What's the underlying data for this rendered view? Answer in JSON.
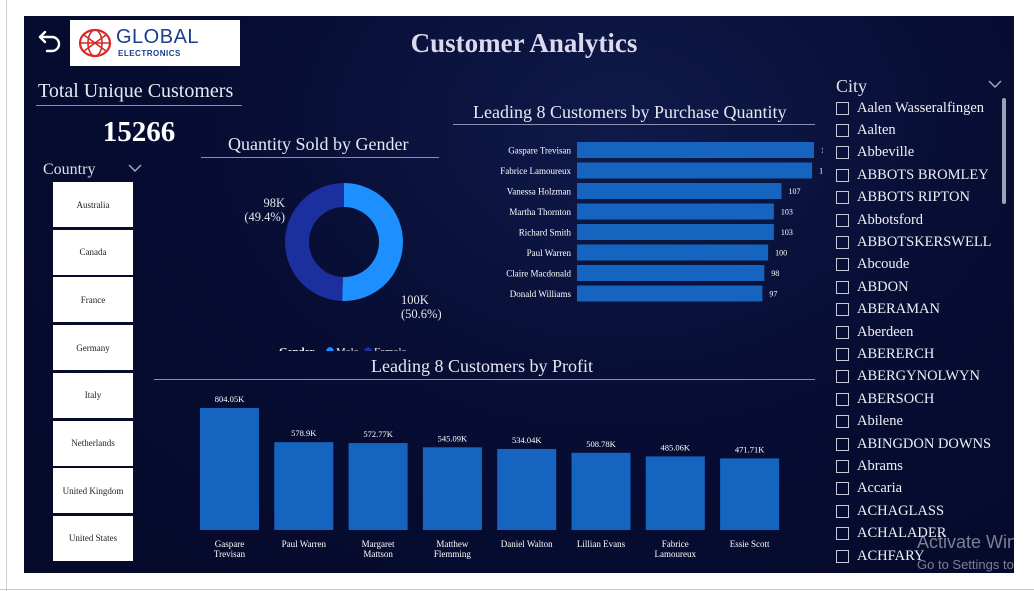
{
  "header": {
    "title": "Customer Analytics",
    "logo_main": "GLOBAL",
    "logo_sub": "ELECTRONICS"
  },
  "kpi": {
    "label": "Total Unique Customers",
    "value": "15266"
  },
  "country_filter": {
    "label": "Country",
    "items": [
      "Australia",
      "Canada",
      "France",
      "Germany",
      "Italy",
      "Netherlands",
      "United Kingdom",
      "United States"
    ]
  },
  "city_filter": {
    "label": "City",
    "items": [
      "Aalen Wasseralfingen",
      "Aalten",
      "Abbeville",
      "ABBOTS BROMLEY",
      "ABBOTS RIPTON",
      "Abbotsford",
      "ABBOTSKERSWELL",
      "Abcoude",
      "ABDON",
      "ABERAMAN",
      "Aberdeen",
      "ABERERCH",
      "ABERGYNOLWYN",
      "ABERSOCH",
      "Abilene",
      "ABINGDON DOWNS",
      "Abrams",
      "Accaria",
      "ACHAGLASS",
      "ACHALADER",
      "ACHFARY"
    ]
  },
  "watermark": {
    "line1": "Activate Windows",
    "line2": "Go to Settings to activate Windows."
  },
  "colors": {
    "male": "#1e8fff",
    "female": "#1b2f9e",
    "bar": "#1565c0",
    "background": "#060c30"
  },
  "chart_data": [
    {
      "type": "pie",
      "title": "Quantity Sold by Gender",
      "legend_title": "Gender",
      "legend_position": "bottom",
      "slices": [
        {
          "name": "Male",
          "value": 100,
          "label": "100K",
          "percent_label": "(50.6%)"
        },
        {
          "name": "Female",
          "value": 98,
          "label": "98K",
          "percent_label": "(49.4%)"
        }
      ]
    },
    {
      "type": "bar",
      "orientation": "horizontal",
      "title": "Leading 8 Customers by Purchase Quantity",
      "categories": [
        "Gaspare Trevisan",
        "Fabrice Lamoureux",
        "Vanessa Holzman",
        "Martha Thornton",
        "Richard Smith",
        "Paul Warren",
        "Claire Macdonald",
        "Donald Williams"
      ],
      "values": [
        124,
        123,
        107,
        103,
        103,
        100,
        98,
        97
      ],
      "xlim": [
        0,
        124
      ]
    },
    {
      "type": "bar",
      "orientation": "vertical",
      "title": "Leading 8 Customers by Profit",
      "categories": [
        [
          "Gaspare",
          "Trevisan"
        ],
        [
          "Paul Warren"
        ],
        [
          "Margaret",
          "Mattson"
        ],
        [
          "Matthew",
          "Flemming"
        ],
        [
          "Daniel Walton"
        ],
        [
          "Lillian Evans"
        ],
        [
          "Fabrice",
          "Lamoureux"
        ],
        [
          "Essie Scott"
        ]
      ],
      "values": [
        804.05,
        578.9,
        572.77,
        545.09,
        534.04,
        508.78,
        485.06,
        471.71
      ],
      "labels": [
        "804.05K",
        "578.9K",
        "572.77K",
        "545.09K",
        "534.04K",
        "508.78K",
        "485.06K",
        "471.71K"
      ],
      "ylim": [
        0,
        804.05
      ]
    }
  ]
}
